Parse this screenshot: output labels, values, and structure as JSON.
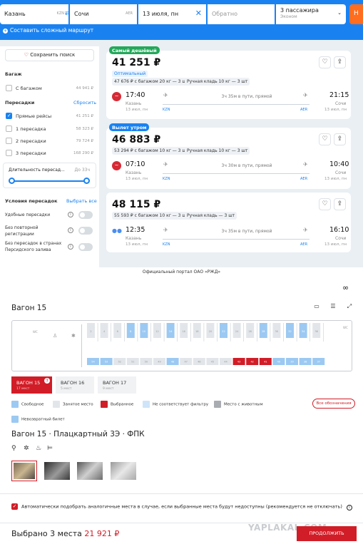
{
  "search": {
    "from": "Казань",
    "from_code": "KZN",
    "to": "Сочи",
    "to_code": "AER",
    "date": "13 июля, пн",
    "return_placeholder": "Обратно",
    "passengers": "3 пассажира",
    "class": "Эконом",
    "find": "Н",
    "complex_route": "Составить сложный маршрут"
  },
  "filters": {
    "save": "Сохранить поиск",
    "baggage_title": "Багаж",
    "baggage_option": "С багажом",
    "baggage_price": "44 941 ₽",
    "transfers_title": "Пересадки",
    "reset": "Сбросить",
    "transfers": [
      {
        "label": "Прямые рейсы",
        "price": "41 251 ₽",
        "checked": true
      },
      {
        "label": "1 пересадка",
        "price": "58 323 ₽",
        "checked": false
      },
      {
        "label": "2 пересадки",
        "price": "79 724 ₽",
        "checked": false
      },
      {
        "label": "3 пересадки",
        "price": "168 290 ₽",
        "checked": false
      }
    ],
    "duration_label": "Длительность пересад...",
    "duration_value": "До 33ч",
    "conditions_title": "Условия пересадок",
    "select_all": "Выбрать все",
    "conditions": [
      {
        "label": "Удобные пересадки"
      },
      {
        "label": "Без повторной регистрации"
      },
      {
        "label": "Без пересадок в странах Персидского залива"
      }
    ]
  },
  "flights": [
    {
      "tag": "Самый дешёвый",
      "tag_color": "#23a85a",
      "price": "41 251 ₽",
      "optimal": "Оптимальный",
      "baggage": "47 676 ₽ с багажом 20 кг — 3 шт",
      "hand": "Ручная кладь 10 кг — 3 шт",
      "dep_time": "17:40",
      "dep_city": "Казань",
      "dep_date": "13 июл, пн",
      "dep_code": "KZN",
      "arr_time": "21:15",
      "arr_city": "Сочи",
      "arr_date": "13 июл, пн",
      "arr_code": "AER",
      "duration": "3ч 35м в пути, прямой"
    },
    {
      "tag": "Вылет утром",
      "tag_color": "#1a82f0",
      "price": "46 883 ₽",
      "baggage": "53 294 ₽ с багажом 10 кг — 3 шт",
      "hand": "Ручная кладь 10 кг — 3 шт",
      "dep_time": "07:10",
      "dep_city": "Казань",
      "dep_date": "13 июл, пн",
      "dep_code": "KZN",
      "arr_time": "10:40",
      "arr_city": "Сочи",
      "arr_date": "13 июл, пн",
      "arr_code": "AER",
      "duration": "3ч 30м в пути, прямой"
    },
    {
      "price": "48 115 ₽",
      "baggage": "55 593 ₽ с багажом 10 кг — 3 шт",
      "hand": "Ручная кладь — 3 шт",
      "dep_time": "12:35",
      "dep_city": "Казань",
      "dep_date": "13 июл, пн",
      "dep_code": "KZN",
      "arr_time": "16:10",
      "arr_city": "Сочи",
      "arr_date": "13 июл, пн",
      "arr_code": "AER",
      "duration": "3ч 35м в пути, прямой"
    }
  ],
  "rzd": {
    "portal": "Официальный портал ОАО «РЖД»",
    "wagon_title": "Вагон 15",
    "map_labels": {
      "wc": "WC",
      "wc2": "WC"
    },
    "tabs": [
      {
        "label": "ВАГОН 15",
        "sub": "17 мест",
        "active": true,
        "badge": "3"
      },
      {
        "label": "ВАГОН 16",
        "sub": "5 мест",
        "active": false
      },
      {
        "label": "ВАГОН 17",
        "sub": "9 мест",
        "active": false
      }
    ],
    "legend": [
      {
        "label": "Свободное",
        "color": "#9cc9f2"
      },
      {
        "label": "Занятое место",
        "color": "#e2e6ea"
      },
      {
        "label": "Выбранное",
        "color": "#d11d27"
      },
      {
        "label": "Не соответствует фильтру",
        "color": "#cfe4f8"
      },
      {
        "label": "Место с животным",
        "color": "#a9adb2"
      },
      {
        "label": "Невозвратный билет",
        "color": "#9cc9f2"
      }
    ],
    "all_legend": "Все обозначения",
    "car_heading": "Вагон 15 · Плацкартный 3Э · ФПК",
    "autopick": "Автоматически подобрать аналогичные места в случае, если выбранные места будут недоступны (рекомендуется не отключать)",
    "selected_label": "Выбрано 3 места",
    "selected_sum": "21 921 ₽",
    "continue": "ПРОДОЛЖИТЬ",
    "watermark": "YAPLAKAL.COM",
    "upper_seats": [
      "2",
      "4",
      "6",
      "8",
      "10",
      "12",
      "14",
      "16",
      "18",
      "20",
      "22",
      "24",
      "26",
      "28",
      "30",
      "32",
      "34",
      "36"
    ],
    "lower_seats": [
      "54",
      "53",
      "52",
      "51",
      "50",
      "49",
      "48",
      "47",
      "46",
      "45",
      "44",
      "43",
      "42",
      "41",
      "40",
      "39",
      "38",
      "37"
    ],
    "upper_status": [
      "busy",
      "busy",
      "busy",
      "free",
      "free",
      "busy",
      "free",
      "busy",
      "busy",
      "busy",
      "free",
      "busy",
      "busy",
      "free",
      "busy",
      "free",
      "free",
      "busy"
    ],
    "lower_status": [
      "free",
      "free",
      "busy",
      "busy",
      "busy",
      "busy",
      "free",
      "busy",
      "busy",
      "busy",
      "busy",
      "sel",
      "sel",
      "sel",
      "free",
      "free",
      "free",
      "free"
    ]
  }
}
